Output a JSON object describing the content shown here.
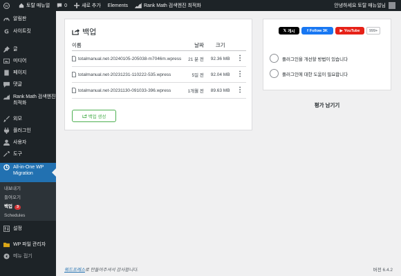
{
  "adminbar": {
    "site_name": "토탈 매뉴얼",
    "comments_count": "0",
    "new_label": "새로 추가",
    "elements_label": "Elements",
    "rankmath_label": "Rank Math 검색엔진 최적화",
    "greeting": "안녕하세요 토탈 매뉴얼님"
  },
  "sidebar": {
    "dashboard": "알림판",
    "sitekit": "사이트킷",
    "posts": "글",
    "media": "미디어",
    "pages": "페이지",
    "comments": "댓글",
    "rankmath": "Rank Math 검색엔진 최적화",
    "appearance": "외모",
    "plugins": "플러그인",
    "users": "사용자",
    "tools": "도구",
    "ai1wm": "All-in-One WP Migration",
    "sub_export": "내보내기",
    "sub_import": "들여오기",
    "sub_backups": "백업",
    "sub_backups_badge": "3",
    "sub_schedules": "Schedules",
    "settings": "설정",
    "filemanager": "WP 파일 관리자",
    "collapse": "메뉴 접기"
  },
  "backups": {
    "title": "백업",
    "headers": {
      "name": "이름",
      "date": "날짜",
      "size": "크기"
    },
    "rows": [
      {
        "name": "totalmanual.net-20240105-205038-m7046m.wpress",
        "date": "21 분 전",
        "size": "92.36 MB"
      },
      {
        "name": "totalmanual.net-20231231-110222-535.wpress",
        "date": "5일 전",
        "size": "92.04 MB"
      },
      {
        "name": "totalmanual.net-20231130-091033-396.wpress",
        "date": "1개월 전",
        "size": "89.63 MB"
      }
    ],
    "create_label": "백업 생성"
  },
  "side": {
    "x_label": "개시",
    "fb_label": "Follow 3K",
    "yt_label": "YouTube",
    "yt_count": "999+",
    "feedback_improve": "플러그인을 개선할 방법이 있습니다",
    "feedback_help": "플러그인에 대한 도움이 필요합니다",
    "review_title": "평가 남기기"
  },
  "footer": {
    "link": "워드프레스",
    "text": "로 만들어주셔서 감사합니다.",
    "version": "버전 6.4.2"
  },
  "colors": {
    "adminbar_bg": "#1d2327",
    "current_menu": "#2271b1",
    "create_button": "#4caf50",
    "badge": "#d63638"
  }
}
